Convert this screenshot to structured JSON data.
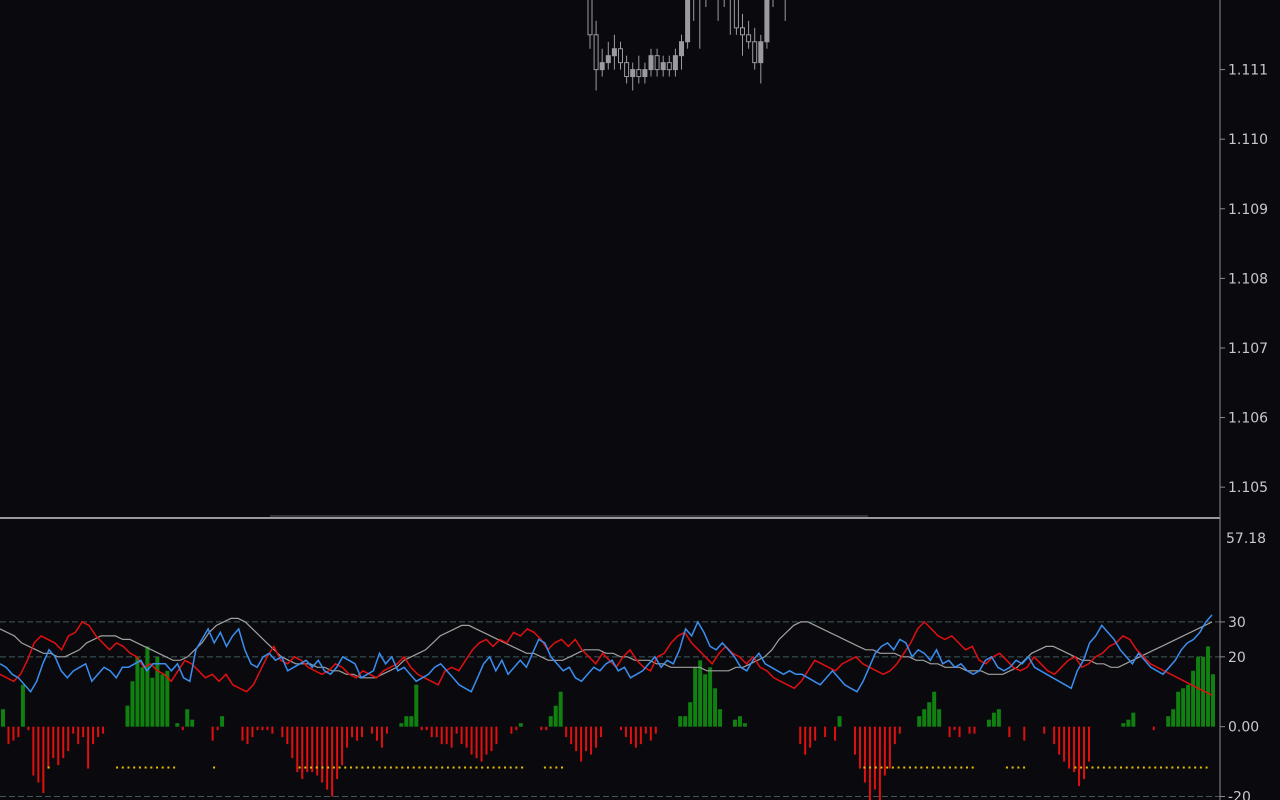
{
  "colors": {
    "background": "#0a0a0e",
    "candle": "#9a9aa0",
    "axis": "#8a8a90",
    "axis_text": "#c8c8cc",
    "level_line": "#3d5a5a",
    "hist_pos": "#108010",
    "hist_neg": "#e01010",
    "plus_di": "#3a8ef0",
    "minus_di": "#e01010",
    "adx": "#a0a0a0",
    "dots": "#e6c000"
  },
  "price_axis": {
    "labels": [
      "1.111",
      "1.110",
      "1.109",
      "1.108",
      "1.107",
      "1.106",
      "1.105"
    ]
  },
  "indicator_axis": {
    "max_label": "57.18",
    "labels": [
      "30",
      "20",
      "0.00",
      "-20"
    ]
  },
  "chart_data": [
    {
      "type": "candlestick",
      "ylim": [
        1.1047,
        1.1121
      ],
      "candles": [
        {
          "o": 1.1125,
          "h": 1.1127,
          "l": 1.1114,
          "c": 1.1116
        },
        {
          "o": 1.1116,
          "h": 1.1118,
          "l": 1.1108,
          "c": 1.1111
        },
        {
          "o": 1.1111,
          "h": 1.1114,
          "l": 1.111,
          "c": 1.1112
        },
        {
          "o": 1.1112,
          "h": 1.1115,
          "l": 1.1111,
          "c": 1.1113
        },
        {
          "o": 1.1113,
          "h": 1.1116,
          "l": 1.1111,
          "c": 1.1114
        },
        {
          "o": 1.1114,
          "h": 1.1115,
          "l": 1.1111,
          "c": 1.1112
        },
        {
          "o": 1.1112,
          "h": 1.1113,
          "l": 1.1109,
          "c": 1.111
        },
        {
          "o": 1.111,
          "h": 1.1112,
          "l": 1.1108,
          "c": 1.1111
        },
        {
          "o": 1.1111,
          "h": 1.1113,
          "l": 1.1109,
          "c": 1.111
        },
        {
          "o": 1.111,
          "h": 1.1112,
          "l": 1.1109,
          "c": 1.1111
        },
        {
          "o": 1.1111,
          "h": 1.1114,
          "l": 1.111,
          "c": 1.1113
        },
        {
          "o": 1.1113,
          "h": 1.1114,
          "l": 1.111,
          "c": 1.1111
        },
        {
          "o": 1.1111,
          "h": 1.1113,
          "l": 1.111,
          "c": 1.1112
        },
        {
          "o": 1.1112,
          "h": 1.1113,
          "l": 1.111,
          "c": 1.1111
        },
        {
          "o": 1.1111,
          "h": 1.1114,
          "l": 1.111,
          "c": 1.1113
        },
        {
          "o": 1.1113,
          "h": 1.1116,
          "l": 1.1111,
          "c": 1.1115
        },
        {
          "o": 1.1115,
          "h": 1.1125,
          "l": 1.1114,
          "c": 1.1124
        },
        {
          "o": 1.1124,
          "h": 1.1126,
          "l": 1.1118,
          "c": 1.1125
        },
        {
          "o": 1.1125,
          "h": 1.1126,
          "l": 1.1114,
          "c": 1.1123
        },
        {
          "o": 1.1123,
          "h": 1.1125,
          "l": 1.112,
          "c": 1.1124
        },
        {
          "o": 1.1124,
          "h": 1.1125,
          "l": 1.1121,
          "c": 1.1122
        },
        {
          "o": 1.1122,
          "h": 1.1124,
          "l": 1.1118,
          "c": 1.1123
        },
        {
          "o": 1.1123,
          "h": 1.1125,
          "l": 1.112,
          "c": 1.1124
        },
        {
          "o": 1.1124,
          "h": 1.1126,
          "l": 1.1116,
          "c": 1.1122
        },
        {
          "o": 1.1122,
          "h": 1.1124,
          "l": 1.1116,
          "c": 1.1117
        },
        {
          "o": 1.1117,
          "h": 1.1119,
          "l": 1.1113,
          "c": 1.1116
        },
        {
          "o": 1.1116,
          "h": 1.1118,
          "l": 1.1114,
          "c": 1.1115
        },
        {
          "o": 1.1115,
          "h": 1.1117,
          "l": 1.1111,
          "c": 1.1112
        },
        {
          "o": 1.1112,
          "h": 1.1116,
          "l": 1.1109,
          "c": 1.1115
        },
        {
          "o": 1.1115,
          "h": 1.1125,
          "l": 1.1114,
          "c": 1.1124
        },
        {
          "o": 1.1124,
          "h": 1.1126,
          "l": 1.112,
          "c": 1.1125
        },
        {
          "o": 1.1125,
          "h": 1.1127,
          "l": 1.1122,
          "c": 1.1126
        },
        {
          "o": 1.1126,
          "h": 1.1128,
          "l": 1.1118,
          "c": 1.1127
        }
      ]
    },
    {
      "type": "indicator",
      "ylim": [
        -21,
        57.18
      ],
      "levels": [
        30,
        20,
        -20
      ],
      "histogram": [
        5,
        -5,
        -4,
        -3,
        12,
        -1,
        -14,
        -16,
        -19,
        -12,
        -9,
        -11,
        -9,
        -7,
        -2,
        -5,
        -3,
        -12,
        -5,
        -3,
        -2,
        0,
        0,
        0,
        0,
        6,
        13,
        20,
        17,
        23,
        14,
        20,
        15,
        16,
        0,
        1,
        -1,
        5,
        2,
        0,
        0,
        0,
        -4,
        -1,
        3,
        0,
        0,
        0,
        -4,
        -5,
        -3,
        -1,
        -1,
        -1,
        -2,
        0,
        -3,
        -5,
        -9,
        -13,
        -15,
        -13,
        -13,
        -14,
        -16,
        -18,
        -20,
        -15,
        -11,
        -6,
        -3,
        -4,
        -3,
        0,
        -2,
        -4,
        -6,
        -2,
        0,
        0,
        1,
        3,
        3,
        12,
        -1,
        -1,
        -3,
        -3,
        -5,
        -5,
        -6,
        -2,
        -5,
        -6,
        -8,
        -9,
        -10,
        -8,
        -7,
        -5,
        0,
        0,
        -2,
        -1,
        1,
        0,
        0,
        0,
        -1,
        -1,
        3,
        6,
        10,
        -3,
        -5,
        -7,
        -10,
        -7,
        -8,
        -6,
        -3,
        0,
        0,
        0,
        -1,
        -3,
        -5,
        -6,
        -5,
        -2,
        -4,
        -2,
        0,
        0,
        0,
        0,
        3,
        3,
        7,
        17,
        19,
        15,
        17,
        11,
        5,
        0,
        0,
        2,
        3,
        1,
        0,
        0,
        0,
        0,
        0,
        0,
        0,
        0,
        0,
        0,
        -5,
        -8,
        -6,
        -4,
        0,
        -3,
        0,
        -4,
        3,
        0,
        0,
        -8,
        -12,
        -16,
        -21,
        -18,
        -21,
        -14,
        -12,
        -5,
        -2,
        0,
        0,
        0,
        3,
        5,
        7,
        10,
        5,
        0,
        -3,
        -1,
        -3,
        0,
        -2,
        -2,
        0,
        0,
        2,
        4,
        5,
        0,
        -3,
        0,
        0,
        -4,
        0,
        0,
        0,
        -2,
        0,
        -5,
        -8,
        -10,
        -12,
        -13,
        -17,
        -15,
        -10,
        0,
        0,
        0,
        0,
        0,
        0,
        1,
        2,
        4,
        0,
        0,
        0,
        -1,
        0,
        0,
        3,
        5,
        10,
        11,
        12,
        16,
        20,
        20,
        23,
        15
      ],
      "plus_di": [
        18,
        17,
        15,
        14,
        12,
        10,
        13,
        18,
        22,
        20,
        16,
        14,
        16,
        17,
        18,
        13,
        15,
        17,
        16,
        14,
        17,
        17,
        18,
        19,
        16,
        18,
        18,
        18,
        16,
        18,
        14,
        13,
        22,
        25,
        28,
        24,
        27,
        23,
        26,
        28,
        22,
        18,
        17,
        20,
        21,
        19,
        20,
        16,
        17,
        18,
        19,
        17,
        19,
        16,
        15,
        17,
        20,
        19,
        18,
        14,
        15,
        16,
        21,
        18,
        20,
        16,
        17,
        15,
        13,
        14,
        15,
        17,
        18,
        16,
        14,
        12,
        11,
        10,
        14,
        18,
        20,
        16,
        19,
        15,
        17,
        19,
        17,
        21,
        25,
        24,
        20,
        18,
        16,
        17,
        14,
        13,
        15,
        17,
        16,
        18,
        19,
        16,
        17,
        14,
        15,
        16,
        18,
        20,
        17,
        19,
        18,
        22,
        28,
        26,
        30,
        27,
        23,
        22,
        24,
        22,
        20,
        17,
        16,
        19,
        21,
        18,
        17,
        16,
        15,
        16,
        15,
        15,
        14,
        13,
        12,
        14,
        16,
        14,
        12,
        11,
        10,
        13,
        17,
        21,
        23,
        24,
        22,
        25,
        24,
        20,
        22,
        21,
        19,
        22,
        18,
        19,
        17,
        18,
        16,
        15,
        16,
        19,
        20,
        17,
        16,
        17,
        19,
        18,
        20,
        17,
        16,
        15,
        14,
        13,
        12,
        11,
        16,
        19,
        24,
        26,
        29,
        27,
        25,
        22,
        20,
        18,
        21,
        19,
        17,
        16,
        15,
        17,
        19,
        22,
        24,
        25,
        27,
        30,
        32
      ],
      "minus_di": [
        15,
        14,
        13,
        15,
        19,
        24,
        26,
        25,
        24,
        22,
        26,
        27,
        30,
        29,
        26,
        24,
        22,
        24,
        23,
        21,
        20,
        17,
        18,
        16,
        15,
        13,
        16,
        19,
        18,
        16,
        14,
        15,
        13,
        15,
        12,
        11,
        10,
        12,
        16,
        20,
        23,
        19,
        18,
        20,
        19,
        17,
        16,
        15,
        16,
        18,
        17,
        15,
        14,
        16,
        15,
        14,
        16,
        17,
        18,
        20,
        17,
        15,
        14,
        13,
        12,
        16,
        17,
        16,
        19,
        22,
        24,
        25,
        23,
        25,
        24,
        27,
        26,
        28,
        27,
        25,
        22,
        24,
        25,
        23,
        25,
        22,
        20,
        18,
        21,
        19,
        17,
        20,
        22,
        19,
        17,
        16,
        20,
        21,
        24,
        26,
        27,
        24,
        22,
        20,
        18,
        21,
        23,
        21,
        20,
        18,
        20,
        17,
        16,
        14,
        13,
        12,
        11,
        13,
        16,
        19,
        18,
        17,
        16,
        18,
        19,
        20,
        18,
        17,
        16,
        15,
        16,
        18,
        21,
        24,
        28,
        30,
        28,
        26,
        25,
        26,
        24,
        22,
        23,
        19,
        18,
        20,
        21,
        19,
        17,
        16,
        17,
        20,
        18,
        16,
        15,
        17,
        19,
        20,
        17,
        18,
        20,
        21,
        23,
        24,
        26,
        25,
        22,
        20,
        18,
        17,
        16,
        15,
        14,
        13,
        12,
        11,
        10,
        9
      ],
      "adx": [
        28,
        27,
        26,
        24,
        23,
        22,
        21,
        21,
        20,
        20,
        21,
        22,
        24,
        25,
        26,
        26,
        26,
        25,
        25,
        24,
        23,
        22,
        21,
        20,
        19,
        19,
        20,
        22,
        24,
        27,
        29,
        30,
        31,
        31,
        30,
        28,
        26,
        24,
        22,
        20,
        19,
        18,
        18,
        18,
        17,
        17,
        16,
        16,
        15,
        15,
        14,
        14,
        14,
        15,
        16,
        17,
        19,
        20,
        21,
        22,
        24,
        26,
        27,
        28,
        29,
        29,
        28,
        27,
        26,
        25,
        24,
        23,
        22,
        21,
        21,
        20,
        19,
        19,
        19,
        20,
        21,
        22,
        22,
        22,
        21,
        21,
        20,
        20,
        19,
        19,
        19,
        18,
        18,
        17,
        17,
        17,
        17,
        17,
        16,
        16,
        16,
        16,
        17,
        17,
        18,
        19,
        20,
        22,
        25,
        27,
        29,
        30,
        30,
        29,
        28,
        27,
        26,
        25,
        24,
        23,
        22,
        22,
        21,
        21,
        21,
        20,
        20,
        19,
        19,
        18,
        18,
        17,
        17,
        17,
        16,
        16,
        16,
        15,
        15,
        15,
        16,
        17,
        19,
        21,
        22,
        23,
        23,
        22,
        21,
        20,
        19,
        19,
        18,
        18,
        17,
        17,
        18,
        19,
        20,
        21,
        22,
        23,
        24,
        25,
        26,
        27,
        28,
        29,
        30
      ],
      "markers": [
        0,
        0,
        0,
        0,
        0,
        0,
        0,
        0,
        1,
        0,
        0,
        0,
        0,
        0,
        0,
        0,
        0,
        0,
        0,
        0,
        1,
        1,
        1,
        1,
        1,
        1,
        1,
        1,
        1,
        1,
        1,
        0,
        0,
        0,
        0,
        0,
        0,
        1,
        0,
        0,
        0,
        0,
        0,
        0,
        0,
        0,
        0,
        0,
        0,
        0,
        0,
        0,
        1,
        1,
        1,
        1,
        1,
        1,
        1,
        1,
        1,
        1,
        1,
        1,
        1,
        1,
        1,
        1,
        1,
        1,
        1,
        1,
        1,
        1,
        1,
        1,
        1,
        1,
        1,
        1,
        1,
        1,
        1,
        1,
        1,
        1,
        1,
        1,
        1,
        1,
        1,
        1,
        0,
        0,
        0,
        1,
        1,
        1,
        1,
        0,
        0,
        0,
        0,
        0,
        0,
        0,
        0,
        0,
        0,
        0,
        0,
        0,
        0,
        0,
        0,
        0,
        0,
        0,
        0,
        0,
        0,
        0,
        0,
        0,
        0,
        0,
        0,
        0,
        0,
        0,
        0,
        0,
        0,
        0,
        0,
        0,
        0,
        0,
        0,
        0,
        0,
        0,
        0,
        0,
        0,
        0,
        0,
        0,
        0,
        0,
        0,
        1,
        1,
        1,
        1,
        1,
        1,
        1,
        1,
        1,
        1,
        1,
        1,
        1,
        1,
        1,
        1,
        1,
        1,
        1,
        1,
        0,
        0,
        0,
        0,
        0,
        1,
        1,
        1,
        1,
        0,
        0,
        0,
        0,
        0,
        0,
        0,
        0,
        1,
        1,
        1,
        1,
        1,
        1,
        1,
        1,
        1,
        1,
        1,
        1,
        1,
        1,
        1,
        1,
        1,
        1,
        1,
        1,
        1,
        1,
        1,
        1,
        0
      ]
    }
  ]
}
